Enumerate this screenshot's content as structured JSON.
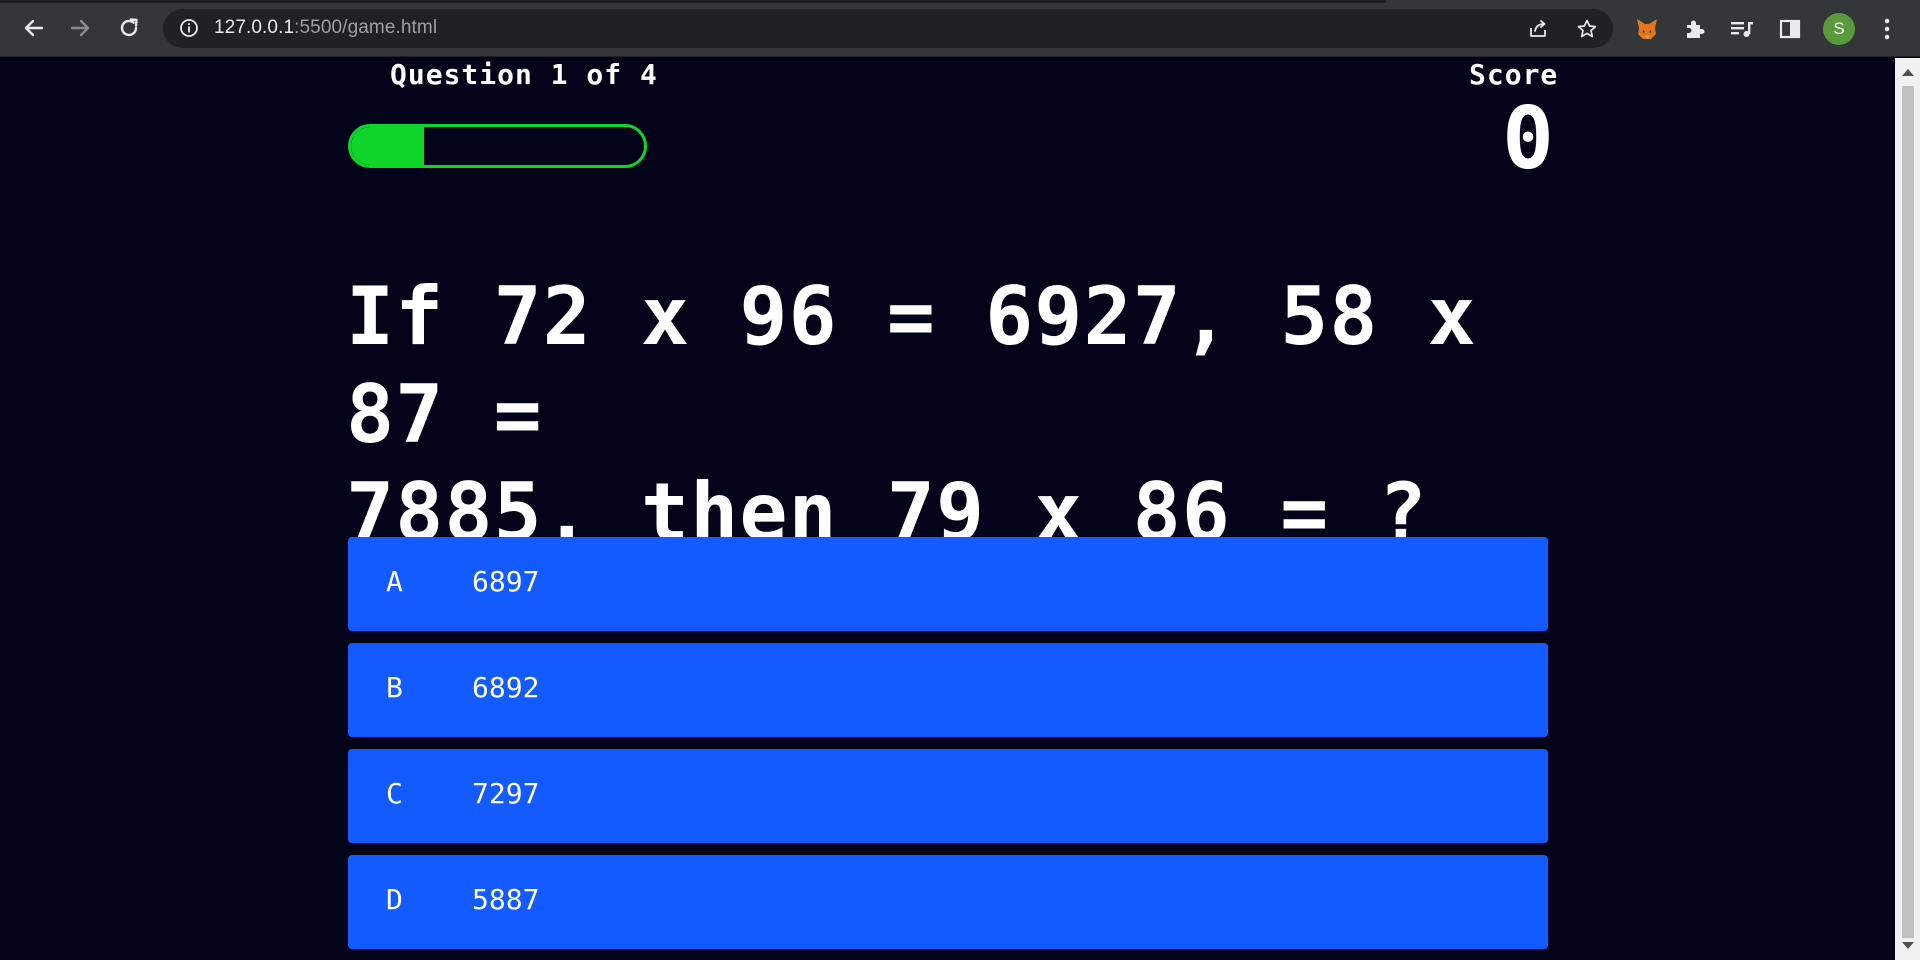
{
  "browser": {
    "url_host": "127.0.0.1",
    "url_rest": ":5500/game.html",
    "profile_initial": "S",
    "icons": [
      "back-arrow-icon",
      "forward-arrow-icon",
      "reload-icon",
      "info-icon",
      "share-icon",
      "star-icon",
      "metamask-fox-icon",
      "extensions-puzzle-icon",
      "media-queue-icon",
      "side-panel-icon",
      "kebab-menu-icon"
    ]
  },
  "hud": {
    "progress_text": "Question 1 of 4",
    "progress_fraction": 0.25,
    "progress_color": "#0fd42a",
    "score_label": "Score",
    "score_value": "0"
  },
  "question": {
    "line1": "If 72 x 96 = 6927, 58 x 87 =",
    "line2": "7885, then 79 x 86 = ?"
  },
  "choices": [
    {
      "prefix": "A",
      "text": "6897"
    },
    {
      "prefix": "B",
      "text": "6892"
    },
    {
      "prefix": "C",
      "text": "7297"
    },
    {
      "prefix": "D",
      "text": "5887"
    }
  ],
  "colors": {
    "background": "#03041a",
    "choice_bg": "#135bfe",
    "text": "#ffffff"
  }
}
